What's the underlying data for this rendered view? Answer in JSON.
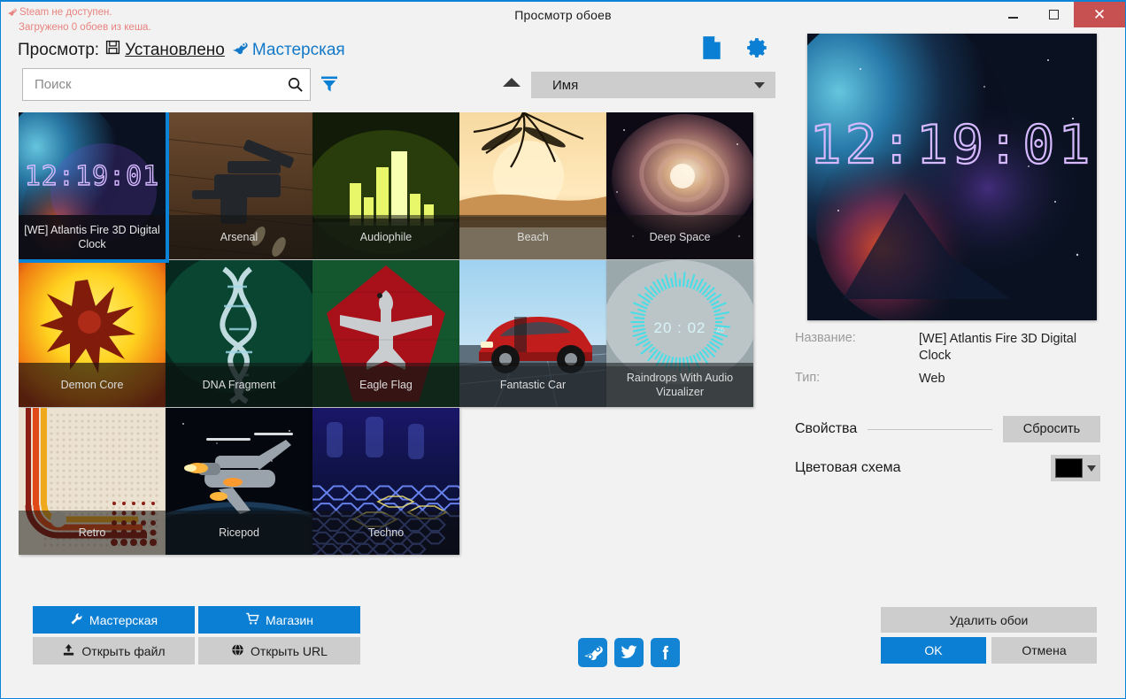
{
  "window": {
    "title": "Просмотр обоев",
    "accent_color": "#0b7fd4",
    "close_color": "#c75050",
    "controls": {
      "minimize": "minimize-icon",
      "maximize": "maximize-icon",
      "close": "✕"
    }
  },
  "status": {
    "line1": "Steam не доступен.",
    "line2": "Загружено 0 обоев из кеша.",
    "color": "#e8837f",
    "icon": "steam-icon"
  },
  "view": {
    "label": "Просмотр:",
    "tabs": [
      {
        "label": "Установлено",
        "icon": "floppy-disk-icon",
        "active": true
      },
      {
        "label": "Мастерская",
        "icon": "steam-icon",
        "active": false
      }
    ]
  },
  "search": {
    "placeholder": "Поиск",
    "value": "",
    "icon": "search-icon",
    "filter_icon": "filter-icon"
  },
  "toolbar": {
    "new_file_icon": "file-icon",
    "settings_icon": "gear-icon"
  },
  "sort": {
    "direction_icon": "sort-ascending-icon",
    "selected": "Имя",
    "options": [
      "Имя"
    ]
  },
  "grid": {
    "items": [
      {
        "title": "[WE] Atlantis Fire 3D Digital Clock",
        "selected": true,
        "thumb": "atlantis-fire-clock"
      },
      {
        "title": "Arsenal",
        "selected": false,
        "thumb": "arsenal"
      },
      {
        "title": "Audiophile",
        "selected": false,
        "thumb": "audiophile"
      },
      {
        "title": "Beach",
        "selected": false,
        "thumb": "beach"
      },
      {
        "title": "Deep Space",
        "selected": false,
        "thumb": "deep-space"
      },
      {
        "title": "Demon Core",
        "selected": false,
        "thumb": "demon-core"
      },
      {
        "title": "DNA Fragment",
        "selected": false,
        "thumb": "dna-fragment"
      },
      {
        "title": "Eagle Flag",
        "selected": false,
        "thumb": "eagle-flag"
      },
      {
        "title": "Fantastic Car",
        "selected": false,
        "thumb": "fantastic-car"
      },
      {
        "title": "Raindrops With Audio Vizualizer",
        "selected": false,
        "thumb": "raindrops-visualizer"
      },
      {
        "title": "Retro",
        "selected": false,
        "thumb": "retro"
      },
      {
        "title": "Ricepod",
        "selected": false,
        "thumb": "ricepod"
      },
      {
        "title": "Techno",
        "selected": false,
        "thumb": "techno"
      }
    ]
  },
  "preview": {
    "clock_text": "12:19:01",
    "alt": "atlantis-fire-3d-digital-clock-preview"
  },
  "details": {
    "name_label": "Название:",
    "name_value": "[WE] Atlantis Fire 3D Digital Clock",
    "type_label": "Тип:",
    "type_value": "Web",
    "properties_label": "Свойства",
    "reset_button": "Сбросить",
    "color_scheme_label": "Цветовая схема",
    "color_scheme_value": "#000000"
  },
  "actions": {
    "workshop": "Мастерская",
    "store": "Магазин",
    "open_file": "Открыть файл",
    "open_url": "Открыть URL",
    "delete_wallpaper": "Удалить обои",
    "ok": "OK",
    "cancel": "Отмена"
  },
  "social": [
    {
      "name": "steam-icon"
    },
    {
      "name": "twitter-icon"
    },
    {
      "name": "facebook-icon"
    }
  ]
}
